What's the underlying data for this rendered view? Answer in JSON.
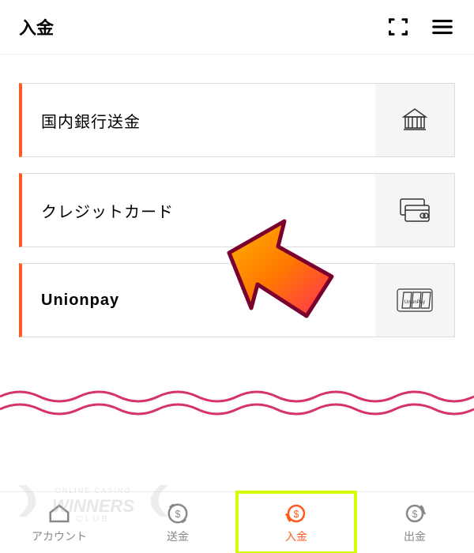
{
  "header": {
    "title": "入金"
  },
  "payment_options": [
    {
      "label": "国内銀行送金",
      "icon": "bank-icon"
    },
    {
      "label": "クレジットカード",
      "icon": "card-icon"
    },
    {
      "label": "Unionpay",
      "icon": "unionpay-icon"
    }
  ],
  "tabbar": {
    "items": [
      {
        "label": "アカウント",
        "icon": "home-icon",
        "active": false
      },
      {
        "label": "送金",
        "icon": "transfer-icon",
        "active": false
      },
      {
        "label": "入金",
        "icon": "deposit-icon",
        "active": true
      },
      {
        "label": "出金",
        "icon": "withdraw-icon",
        "active": false
      }
    ]
  },
  "watermark": {
    "text": "ONLINE CASINO WINNERS CLUB"
  },
  "colors": {
    "accent": "#ff5a1f",
    "highlight": "#d4ff00",
    "wave": "#d6336c"
  }
}
